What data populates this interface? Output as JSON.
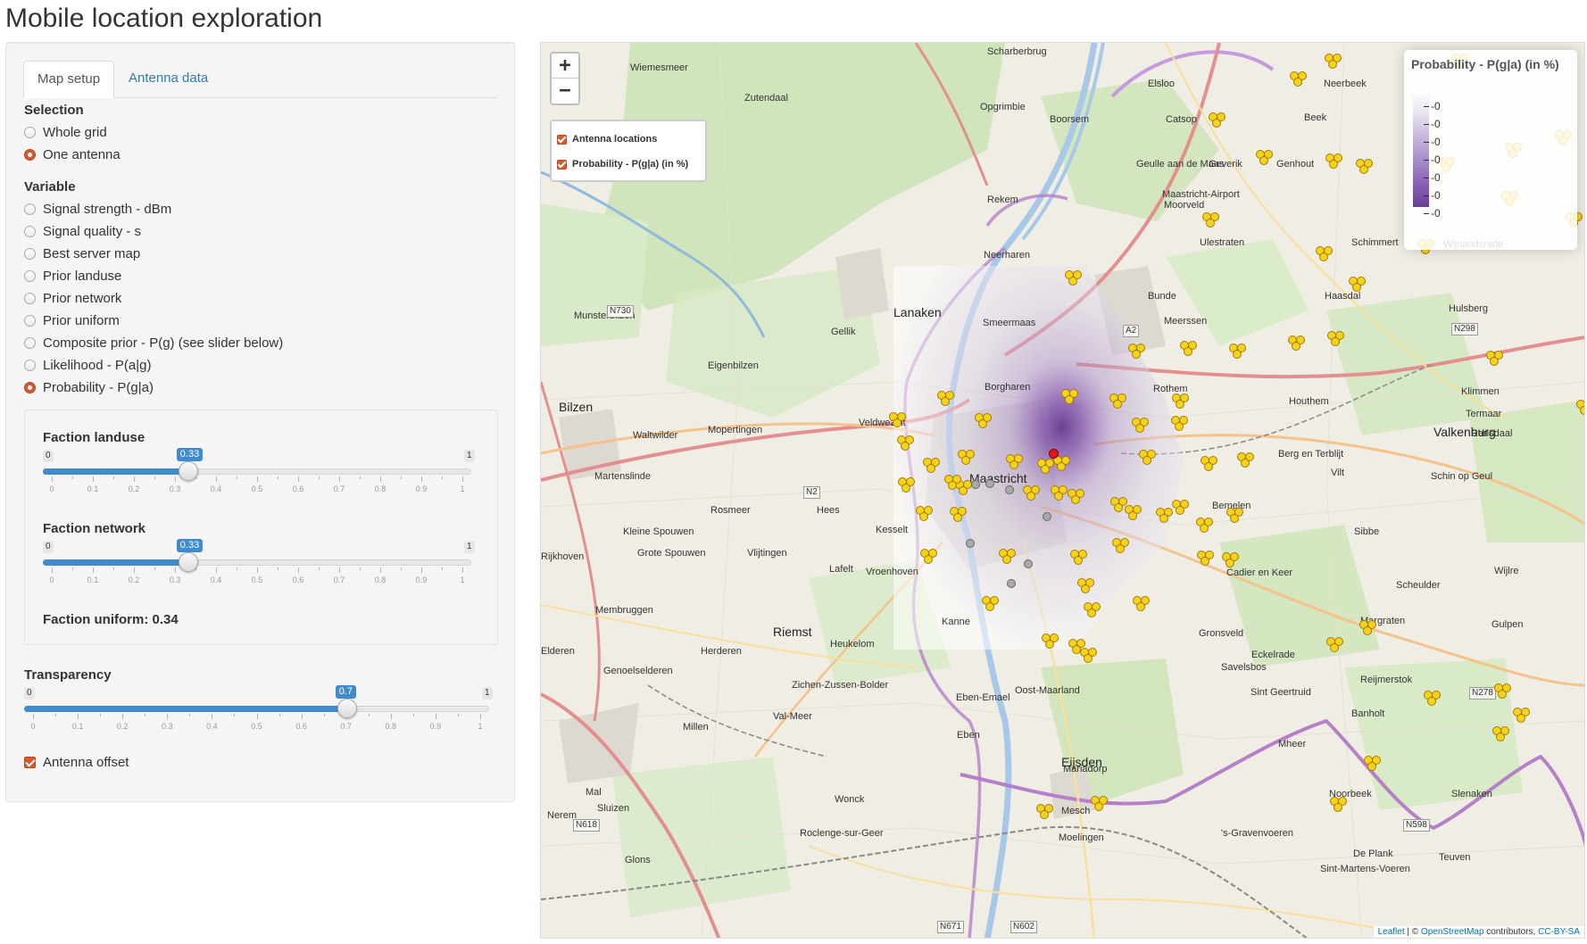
{
  "page": {
    "title": "Mobile location exploration"
  },
  "tabs": [
    {
      "label": "Map setup",
      "active": true
    },
    {
      "label": "Antenna data",
      "active": false
    }
  ],
  "selection": {
    "label": "Selection",
    "options": [
      "Whole grid",
      "One antenna"
    ],
    "selected": "One antenna"
  },
  "variable": {
    "label": "Variable",
    "options": [
      "Signal strength - dBm",
      "Signal quality - s",
      "Best server map",
      "Prior landuse",
      "Prior network",
      "Prior uniform",
      "Composite prior - P(g) (see slider below)",
      "Likelihood - P(a|g)",
      "Probability - P(g|a)"
    ],
    "selected": "Probability - P(g|a)"
  },
  "sliders": {
    "landuse": {
      "label": "Faction landuse",
      "min": "0",
      "max": "1",
      "value": 0.33,
      "value_label": "0.33"
    },
    "network": {
      "label": "Faction network",
      "min": "0",
      "max": "1",
      "value": 0.33,
      "value_label": "0.33"
    },
    "transparency": {
      "label": "Transparency",
      "min": "0",
      "max": "1",
      "value": 0.7,
      "value_label": "0.7"
    },
    "tick_labels": [
      "0",
      "0.1",
      "0.2",
      "0.3",
      "0.4",
      "0.5",
      "0.6",
      "0.7",
      "0.8",
      "0.9",
      "1"
    ]
  },
  "faction_uniform": "Faction uniform: 0.34",
  "antenna_offset": {
    "label": "Antenna offset",
    "checked": true
  },
  "map": {
    "zoom_in": "+",
    "zoom_out": "−",
    "layers": [
      {
        "label": "Antenna locations",
        "checked": true
      },
      {
        "label": "Probability - P(g|a) (in %)",
        "checked": true
      }
    ],
    "legend": {
      "title": "Probability - P(g|a) (in %)",
      "values": [
        "-0",
        "-0",
        "-0",
        "-0",
        "-0",
        "-0",
        "-0"
      ],
      "colors": {
        "low": "#ffffff",
        "high": "#6a3d9a"
      }
    },
    "attribution": {
      "leaflet": "Leaflet",
      "sep": " | © ",
      "osm": "OpenStreetMap",
      "contrib": " contributors, ",
      "license": "CC-BY-SA"
    },
    "places": [
      {
        "name": "Scharberbrug"
      },
      {
        "name": "Wiemesmeer"
      },
      {
        "name": "Zutendaal"
      },
      {
        "name": "Opgrimbie"
      },
      {
        "name": "Boorsem"
      },
      {
        "name": "Elsloo"
      },
      {
        "name": "Neerbeek"
      },
      {
        "name": "Beek"
      },
      {
        "name": "Catsop"
      },
      {
        "name": "Geverik"
      },
      {
        "name": "Genhout"
      },
      {
        "name": "Geulle aan de Maas"
      },
      {
        "name": "Rekem"
      },
      {
        "name": "Moorveld"
      },
      {
        "name": "Maastricht-Airport"
      },
      {
        "name": "Neerharen"
      },
      {
        "name": "Ulestraten"
      },
      {
        "name": "Schimmert"
      },
      {
        "name": "Wijnandsrade"
      },
      {
        "name": "Bunde"
      },
      {
        "name": "Haasdal"
      },
      {
        "name": "Lanaken"
      },
      {
        "name": "Smeermaas"
      },
      {
        "name": "Munsterbilzen"
      },
      {
        "name": "Gellik"
      },
      {
        "name": "Meerssen"
      },
      {
        "name": "Hulsberg"
      },
      {
        "name": "Eigenbilzen"
      },
      {
        "name": "Borgharen"
      },
      {
        "name": "Rothem"
      },
      {
        "name": "Klimmen"
      },
      {
        "name": "Bilzen"
      },
      {
        "name": "Houthem"
      },
      {
        "name": "Termaar"
      },
      {
        "name": "Waltwilder"
      },
      {
        "name": "Mopertingen"
      },
      {
        "name": "Veldwezelt"
      },
      {
        "name": "Valkenburg"
      },
      {
        "name": "Ransdaal"
      },
      {
        "name": "Berg en Terblijt"
      },
      {
        "name": "Vilt"
      },
      {
        "name": "Martenslinde"
      },
      {
        "name": "Maastricht"
      },
      {
        "name": "Schin op Geul"
      },
      {
        "name": "Rosmeer"
      },
      {
        "name": "Hees"
      },
      {
        "name": "Bemelen"
      },
      {
        "name": "Kesselt"
      },
      {
        "name": "Sibbe"
      },
      {
        "name": "Kleine Spouwen"
      },
      {
        "name": "Rijkhoven"
      },
      {
        "name": "Grote Spouwen"
      },
      {
        "name": "Vlijtingen"
      },
      {
        "name": "Lafelt"
      },
      {
        "name": "Vroenhoven"
      },
      {
        "name": "Cadier en Keer"
      },
      {
        "name": "Scheulder"
      },
      {
        "name": "Wijlre"
      },
      {
        "name": "Membruggen"
      },
      {
        "name": "Margraten"
      },
      {
        "name": "Gulpen"
      },
      {
        "name": "Riemst"
      },
      {
        "name": "Kanne"
      },
      {
        "name": "Gronsveld"
      },
      {
        "name": "Heukelom"
      },
      {
        "name": "Herderen"
      },
      {
        "name": "Elderen"
      },
      {
        "name": "Eckelrade"
      },
      {
        "name": "Genoelselderen"
      },
      {
        "name": "Savelsbos"
      },
      {
        "name": "Reijmerstok"
      },
      {
        "name": "Zichen-Zussen-Bolder"
      },
      {
        "name": "Eben-Emael"
      },
      {
        "name": "Oost-Maarland"
      },
      {
        "name": "Sint Geertruid"
      },
      {
        "name": "Banholt"
      },
      {
        "name": "Millen"
      },
      {
        "name": "Val-Meer"
      },
      {
        "name": "Eben"
      },
      {
        "name": "Mheer"
      },
      {
        "name": "Eijsden"
      },
      {
        "name": "Mariadorp"
      },
      {
        "name": "Noorbeek"
      },
      {
        "name": "Slenaken"
      },
      {
        "name": "Mal"
      },
      {
        "name": "Wonck"
      },
      {
        "name": "Mesch"
      },
      {
        "name": "Sluizen"
      },
      {
        "name": "Nerem"
      },
      {
        "name": "Moelingen"
      },
      {
        "name": "Roclenge-sur-Geer"
      },
      {
        "name": "'s-Gravenvoeren"
      },
      {
        "name": "De Plank"
      },
      {
        "name": "Teuven"
      },
      {
        "name": "Glons"
      },
      {
        "name": "Sint-Martens-Voeren"
      }
    ],
    "road_labels": [
      "N730",
      "N2",
      "A2",
      "N298",
      "N278",
      "N618",
      "N598",
      "N671",
      "N602"
    ]
  }
}
